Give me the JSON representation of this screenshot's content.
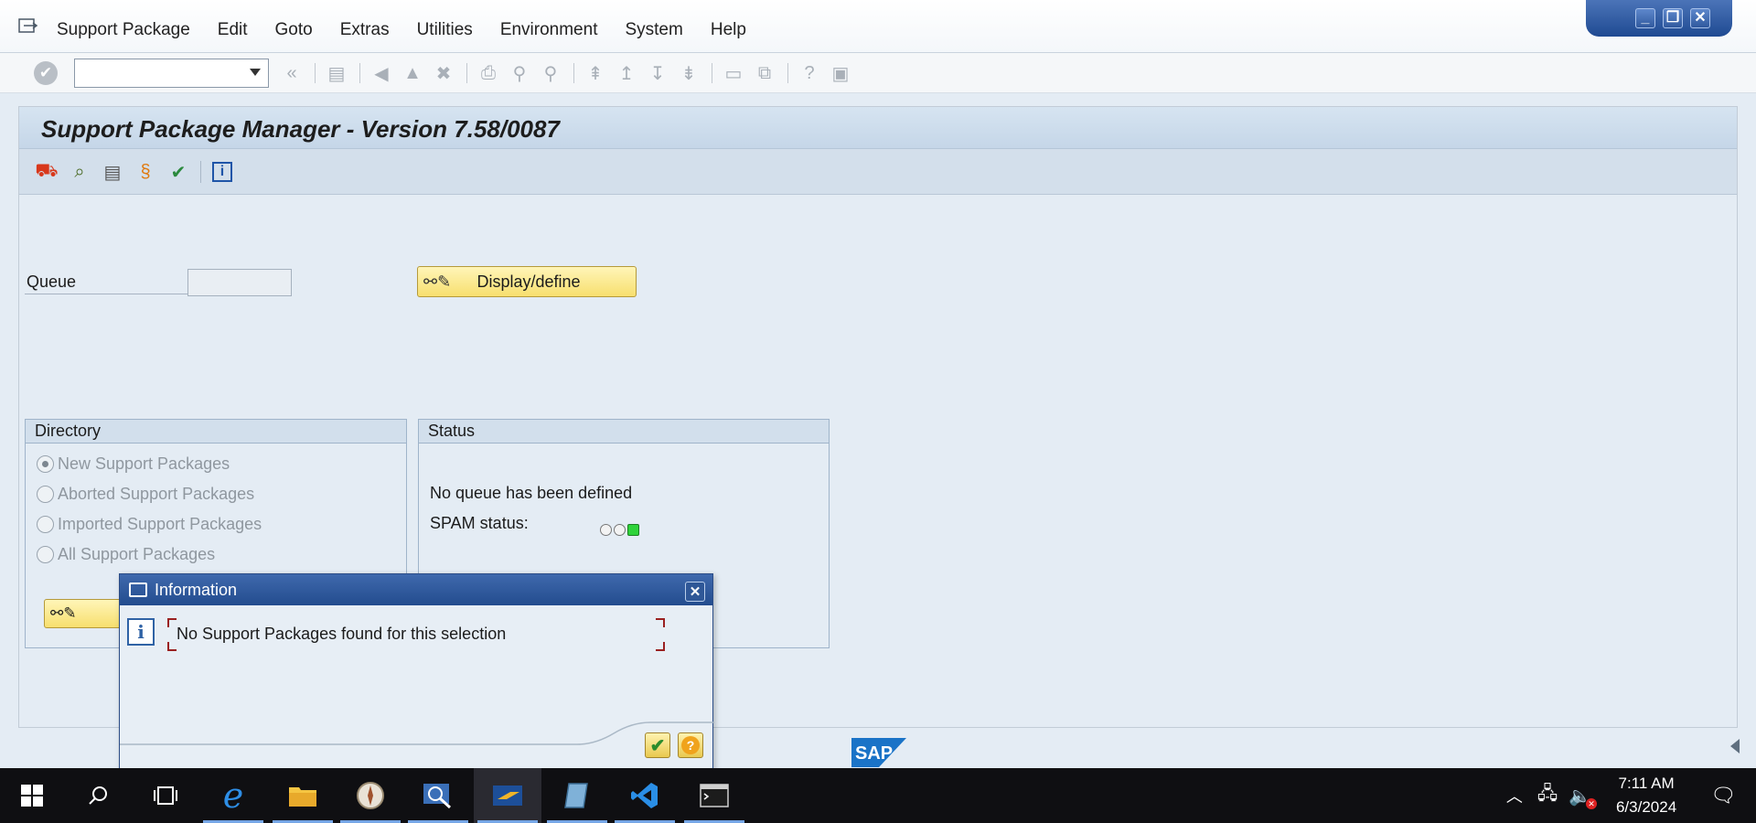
{
  "menu": {
    "items": [
      "Support Package",
      "Edit",
      "Goto",
      "Extras",
      "Utilities",
      "Environment",
      "System",
      "Help"
    ]
  },
  "window_controls": [
    "minimize",
    "restore",
    "close"
  ],
  "toolbar": {
    "command_field_value": "",
    "icons": [
      "enter-icon",
      "back-icon",
      "save-icon",
      "prev-screen-icon",
      "exit-icon",
      "cancel-icon",
      "print-icon",
      "find-icon",
      "find-next-icon",
      "first-page-icon",
      "prev-page-icon",
      "next-page-icon",
      "last-page-icon",
      "new-session-icon",
      "shortcut-icon",
      "help-icon",
      "layout-icon"
    ]
  },
  "screen": {
    "title": "Support Package Manager - Version 7.58/0087",
    "app_icons": [
      "import-queue-icon",
      "display-icon",
      "display-log-icon",
      "ocs-icon",
      "confirm-icon",
      "info-icon"
    ],
    "queue": {
      "label": "Queue",
      "value": "",
      "button_label": "Display/define"
    },
    "directory": {
      "title": "Directory",
      "options": [
        {
          "label": "New Support Packages",
          "selected": true
        },
        {
          "label": "Aborted Support Packages",
          "selected": false
        },
        {
          "label": "Imported Support Packages",
          "selected": false
        },
        {
          "label": "All Support Packages",
          "selected": false
        }
      ]
    },
    "status": {
      "title": "Status",
      "queue_text": "No queue has been defined",
      "spam_label": "SPAM status:",
      "lights": [
        "off",
        "off",
        "green"
      ]
    },
    "brand": "SAP",
    "brand_color": "#1a73c7"
  },
  "dialog": {
    "title": "Information",
    "message": "No Support Packages found for this selection"
  },
  "taskbar": {
    "apps": [
      "start",
      "search",
      "task-view",
      "internet-explorer",
      "file-explorer",
      "app-circle",
      "sap-logon",
      "sap-gui",
      "sap-app",
      "vscode",
      "terminal"
    ],
    "time": "7:11 AM",
    "date": "6/3/2024"
  }
}
